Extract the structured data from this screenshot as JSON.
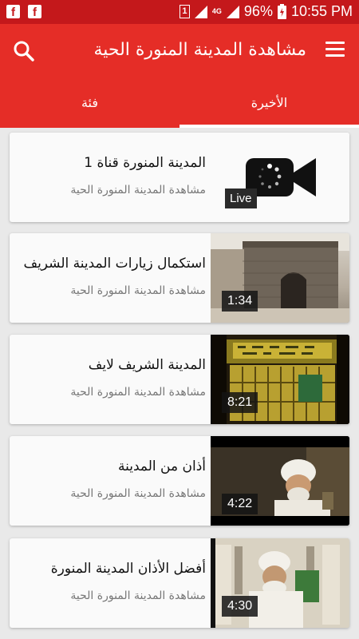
{
  "status_bar": {
    "battery": "96%",
    "time": "10:55 PM",
    "sim": "1",
    "network": "4G"
  },
  "app": {
    "title": "مشاهدة المدينة المنورة الحية",
    "accent": "#e52d27",
    "status_color": "#c4181b"
  },
  "tabs": [
    {
      "label": "الأخيرة",
      "selected": true
    },
    {
      "label": "فئة",
      "selected": false
    }
  ],
  "videos": [
    {
      "title": "المدينة المنورة قناة 1",
      "channel": "مشاهدة المدينة المنورة الحية",
      "badge": "Live",
      "thumb": "video-camera-icon"
    },
    {
      "title": "استكمال زيارات المدينة الشريف",
      "channel": "مشاهدة المدينة المنورة الحية",
      "badge": "1:34",
      "thumb": "stone-building-photo"
    },
    {
      "title": "المدينة الشريف لايف",
      "channel": "مشاهدة المدينة المنورة الحية",
      "badge": "8:21",
      "thumb": "prophet-chamber-gate-photo"
    },
    {
      "title": "أذان من المدينة",
      "channel": "مشاهدة المدينة المنورة الحية",
      "badge": "4:22",
      "thumb": "muezzin-photo"
    },
    {
      "title": "أفضل الأذان المدينة المنورة",
      "channel": "مشاهدة المدينة المنورة الحية",
      "badge": "4:30",
      "thumb": "muezzin-mosque-photo"
    }
  ]
}
